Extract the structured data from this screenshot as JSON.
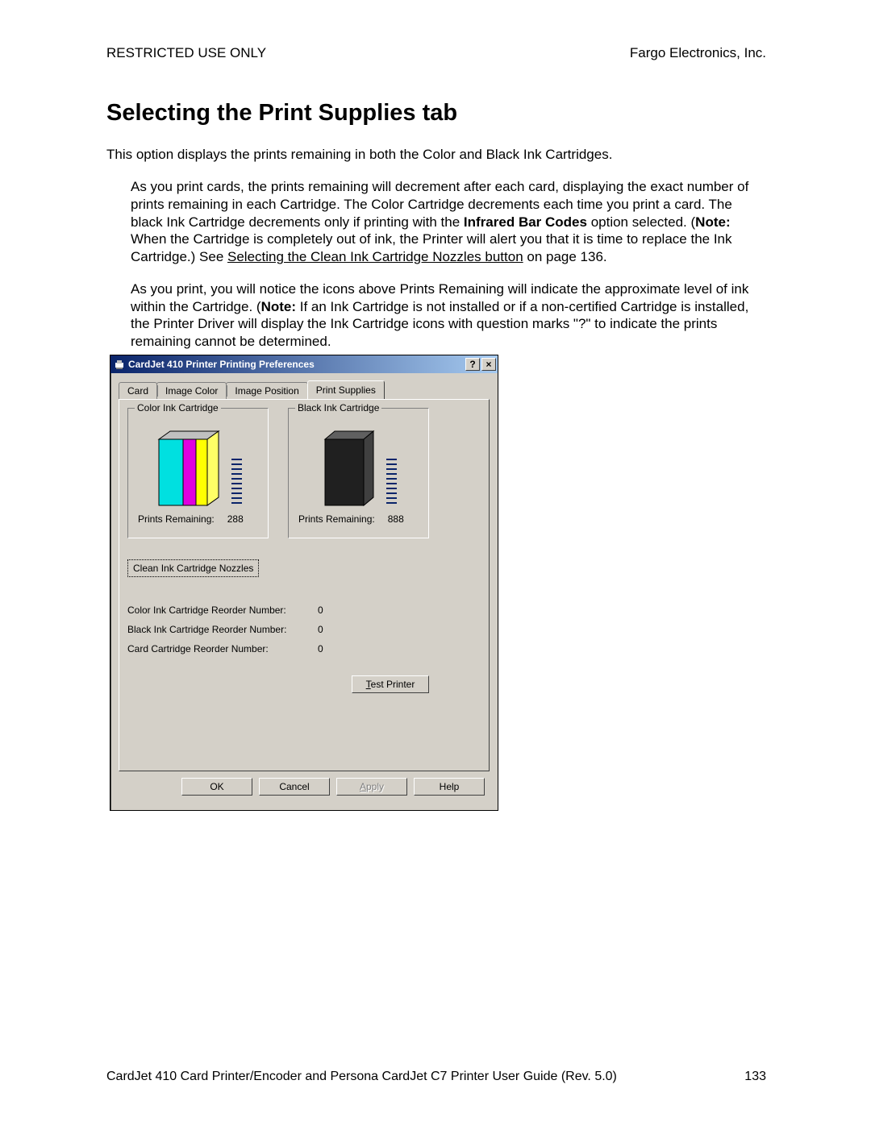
{
  "header": {
    "left": "RESTRICTED USE ONLY",
    "right": "Fargo Electronics, Inc."
  },
  "title": "Selecting the Print Supplies tab",
  "intro": "This option displays the prints remaining in both the Color and Black Ink Cartridges.",
  "para1_a": "As you print cards, the prints remaining will decrement after each card, displaying the exact number of prints remaining in each Cartridge. The Color Cartridge decrements each time you print a card. The black Ink Cartridge decrements only if printing with the ",
  "para1_bold1": "Infrared Bar Codes",
  "para1_b": " option selected. (",
  "para1_bold2": "Note:",
  "para1_c": "  When the Cartridge is completely out of ink, the Printer will alert you that it is time to replace the Ink Cartridge.)  See ",
  "para1_link": "Selecting the Clean Ink Cartridge Nozzles button",
  "para1_d": " on page 136.",
  "para2_a": "As you print, you will notice the icons above Prints Remaining will indicate the approximate level of ink within the Cartridge. (",
  "para2_bold": "Note:",
  "para2_b": "  If an Ink Cartridge is not installed or if a non-certified Cartridge is installed, the Printer Driver will display the Ink Cartridge icons with question marks \"?\" to indicate the prints remaining cannot be determined.",
  "dialog": {
    "title": "CardJet 410 Printer Printing Preferences",
    "help_glyph": "?",
    "close_glyph": "×",
    "tabs": {
      "card": "Card",
      "image_color": "Image Color",
      "image_position": "Image Position",
      "print_supplies": "Print Supplies"
    },
    "group_color": {
      "legend": "Color Ink Cartridge",
      "prints_label": "Prints Remaining:",
      "prints_value": "288"
    },
    "group_black": {
      "legend": "Black Ink Cartridge",
      "prints_label": "Prints Remaining:",
      "prints_value": "888"
    },
    "clean_btn": "Clean Ink Cartridge Nozzles",
    "reorder": {
      "color": {
        "label": "Color Ink Cartridge Reorder Number:",
        "value": "0"
      },
      "black": {
        "label": "Black Ink Cartridge Reorder Number:",
        "value": "0"
      },
      "card": {
        "label": "Card Cartridge Reorder Number:",
        "value": "0"
      }
    },
    "test_btn": "Test Printer",
    "buttons": {
      "ok": "OK",
      "cancel": "Cancel",
      "apply": "Apply",
      "help": "Help"
    }
  },
  "footer": {
    "left": "CardJet 410 Card Printer/Encoder and Persona CardJet C7 Printer User Guide (Rev. 5.0)",
    "right": "133"
  }
}
